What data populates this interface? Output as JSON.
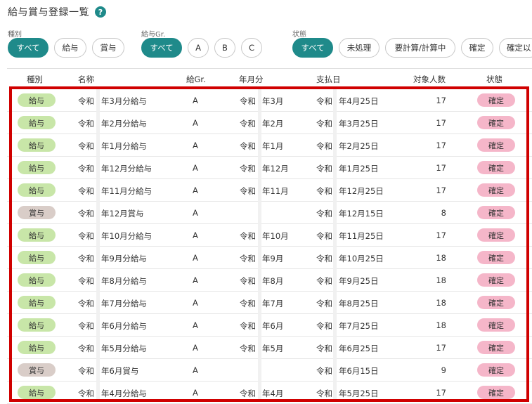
{
  "header": {
    "title": "給与賞与登録一覧",
    "help_icon": "?"
  },
  "filters": {
    "kind": {
      "label": "種別",
      "options": [
        "すべて",
        "給与",
        "賞与"
      ],
      "active": 0
    },
    "group": {
      "label": "給与Gr.",
      "options": [
        "すべて",
        "A",
        "B",
        "C"
      ],
      "active": 0
    },
    "status": {
      "label": "状態",
      "options": [
        "すべて",
        "未処理",
        "要計算/計算中",
        "確定",
        "確定以"
      ],
      "active": 0
    }
  },
  "table": {
    "columns": [
      "種別",
      "名称",
      "給Gr.",
      "年月分",
      "支払日",
      "対象人数",
      "状態"
    ],
    "rows": [
      {
        "kind": "給与",
        "name_era": "令和",
        "name": "年3月分給与",
        "group": "A",
        "ym_era": "令和",
        "ym": "年3月",
        "pay_era": "令和",
        "pay": "年4月25日",
        "count": "17",
        "status": "確定"
      },
      {
        "kind": "給与",
        "name_era": "令和",
        "name": "年2月分給与",
        "group": "A",
        "ym_era": "令和",
        "ym": "年2月",
        "pay_era": "令和",
        "pay": "年3月25日",
        "count": "17",
        "status": "確定"
      },
      {
        "kind": "給与",
        "name_era": "令和",
        "name": "年1月分給与",
        "group": "A",
        "ym_era": "令和",
        "ym": "年1月",
        "pay_era": "令和",
        "pay": "年2月25日",
        "count": "17",
        "status": "確定"
      },
      {
        "kind": "給与",
        "name_era": "令和",
        "name": "年12月分給与",
        "group": "A",
        "ym_era": "令和",
        "ym": "年12月",
        "pay_era": "令和",
        "pay": "年1月25日",
        "count": "17",
        "status": "確定"
      },
      {
        "kind": "給与",
        "name_era": "令和",
        "name": "年11月分給与",
        "group": "A",
        "ym_era": "令和",
        "ym": "年11月",
        "pay_era": "令和",
        "pay": "年12月25日",
        "count": "17",
        "status": "確定"
      },
      {
        "kind": "賞与",
        "name_era": "令和",
        "name": "年12月賞与",
        "group": "A",
        "ym_era": "",
        "ym": "",
        "pay_era": "令和",
        "pay": "年12月15日",
        "count": "8",
        "status": "確定"
      },
      {
        "kind": "給与",
        "name_era": "令和",
        "name": "年10月分給与",
        "group": "A",
        "ym_era": "令和",
        "ym": "年10月",
        "pay_era": "令和",
        "pay": "年11月25日",
        "count": "17",
        "status": "確定"
      },
      {
        "kind": "給与",
        "name_era": "令和",
        "name": "年9月分給与",
        "group": "A",
        "ym_era": "令和",
        "ym": "年9月",
        "pay_era": "令和",
        "pay": "年10月25日",
        "count": "18",
        "status": "確定"
      },
      {
        "kind": "給与",
        "name_era": "令和",
        "name": "年8月分給与",
        "group": "A",
        "ym_era": "令和",
        "ym": "年8月",
        "pay_era": "令和",
        "pay": "年9月25日",
        "count": "18",
        "status": "確定"
      },
      {
        "kind": "給与",
        "name_era": "令和",
        "name": "年7月分給与",
        "group": "A",
        "ym_era": "令和",
        "ym": "年7月",
        "pay_era": "令和",
        "pay": "年8月25日",
        "count": "18",
        "status": "確定"
      },
      {
        "kind": "給与",
        "name_era": "令和",
        "name": "年6月分給与",
        "group": "A",
        "ym_era": "令和",
        "ym": "年6月",
        "pay_era": "令和",
        "pay": "年7月25日",
        "count": "18",
        "status": "確定"
      },
      {
        "kind": "給与",
        "name_era": "令和",
        "name": "年5月分給与",
        "group": "A",
        "ym_era": "令和",
        "ym": "年5月",
        "pay_era": "令和",
        "pay": "年6月25日",
        "count": "17",
        "status": "確定"
      },
      {
        "kind": "賞与",
        "name_era": "令和",
        "name": "年6月賞与",
        "group": "A",
        "ym_era": "",
        "ym": "",
        "pay_era": "令和",
        "pay": "年6月15日",
        "count": "9",
        "status": "確定"
      },
      {
        "kind": "給与",
        "name_era": "令和",
        "name": "年4月分給与",
        "group": "A",
        "ym_era": "令和",
        "ym": "年4月",
        "pay_era": "令和",
        "pay": "年5月25日",
        "count": "17",
        "status": "確定"
      }
    ]
  },
  "colors": {
    "accent": "#1f8a8a",
    "salary_badge": "#c8e6a8",
    "bonus_badge": "#d9cdc8",
    "status_badge": "#f5b6c9",
    "highlight_border": "#d00000"
  }
}
